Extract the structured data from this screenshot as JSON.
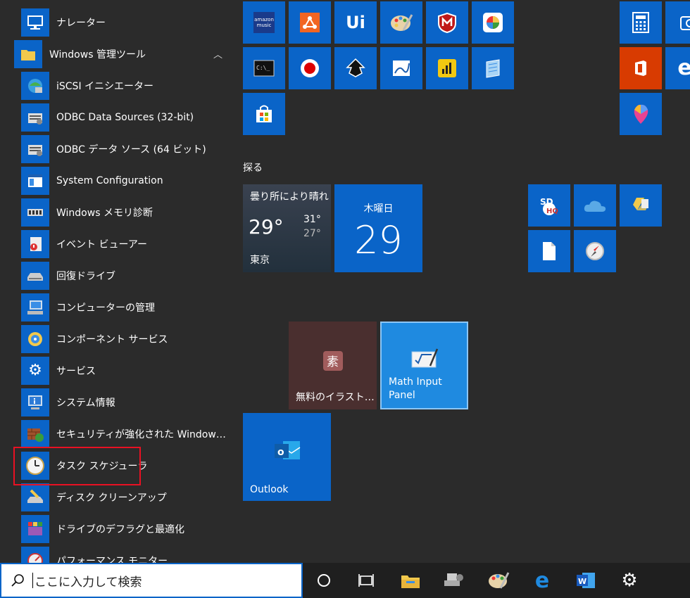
{
  "app_list": {
    "items": [
      {
        "label": "ナレーター",
        "icon": "narrator-icon"
      },
      {
        "label": "Windows 管理ツール",
        "icon": "folder-icon"
      },
      {
        "label": "iSCSI イニシエーター",
        "icon": "iscsi-initiator-icon"
      },
      {
        "label": "ODBC Data Sources (32-bit)",
        "icon": "odbc-32-icon"
      },
      {
        "label": "ODBC データ ソース (64 ビット)",
        "icon": "odbc-64-icon"
      },
      {
        "label": "System Configuration",
        "icon": "system-configuration-icon"
      },
      {
        "label": "Windows メモリ診断",
        "icon": "memory-diagnostic-icon"
      },
      {
        "label": "イベント ビューアー",
        "icon": "event-viewer-icon"
      },
      {
        "label": "回復ドライブ",
        "icon": "recovery-drive-icon"
      },
      {
        "label": "コンピューターの管理",
        "icon": "computer-management-icon"
      },
      {
        "label": "コンポーネント サービス",
        "icon": "component-services-icon"
      },
      {
        "label": "サービス",
        "icon": "services-icon"
      },
      {
        "label": "システム情報",
        "icon": "system-information-icon"
      },
      {
        "label": "セキュリティが強化された Windows Defender ファイアウォール",
        "icon": "firewall-icon"
      },
      {
        "label": "タスク スケジューラ",
        "icon": "task-scheduler-icon"
      },
      {
        "label": "ディスク クリーンアップ",
        "icon": "disk-cleanup-icon"
      },
      {
        "label": "ドライブのデフラグと最適化",
        "icon": "defrag-icon"
      },
      {
        "label": "パフォーマンス モニター",
        "icon": "performance-monitor-icon"
      }
    ],
    "folder_expanded": true
  },
  "tiles": {
    "explore_heading": "探る",
    "weather": {
      "condition": "曇り所により晴れ",
      "current": "29°",
      "high": "31°",
      "low": "27°",
      "city": "東京"
    },
    "calendar": {
      "weekday": "木曜日",
      "day": "29"
    },
    "free_illust": "無料のイラスト…",
    "math_input": "Math Input Panel",
    "outlook": "Outlook",
    "amazon_music_lines": [
      "amazon",
      "music"
    ]
  },
  "taskbar": {
    "search_placeholder": "ここに入力して検索"
  },
  "colors": {
    "tile_blue": "#0a64c8",
    "office_orange": "#d83b01",
    "illust_tile": "#4a2f2f",
    "highlight_red": "#e81123"
  }
}
